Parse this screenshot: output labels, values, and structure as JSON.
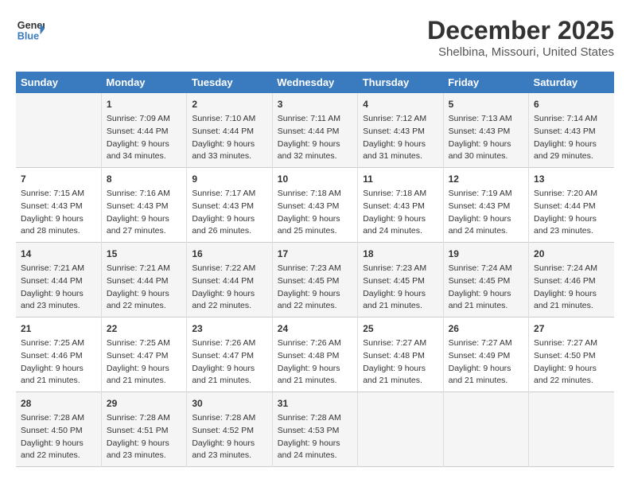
{
  "header": {
    "logo_general": "General",
    "logo_blue": "Blue",
    "month_title": "December 2025",
    "location": "Shelbina, Missouri, United States"
  },
  "days_of_week": [
    "Sunday",
    "Monday",
    "Tuesday",
    "Wednesday",
    "Thursday",
    "Friday",
    "Saturday"
  ],
  "weeks": [
    [
      {
        "day": "",
        "text": ""
      },
      {
        "day": "1",
        "text": "Sunrise: 7:09 AM\nSunset: 4:44 PM\nDaylight: 9 hours\nand 34 minutes."
      },
      {
        "day": "2",
        "text": "Sunrise: 7:10 AM\nSunset: 4:44 PM\nDaylight: 9 hours\nand 33 minutes."
      },
      {
        "day": "3",
        "text": "Sunrise: 7:11 AM\nSunset: 4:44 PM\nDaylight: 9 hours\nand 32 minutes."
      },
      {
        "day": "4",
        "text": "Sunrise: 7:12 AM\nSunset: 4:43 PM\nDaylight: 9 hours\nand 31 minutes."
      },
      {
        "day": "5",
        "text": "Sunrise: 7:13 AM\nSunset: 4:43 PM\nDaylight: 9 hours\nand 30 minutes."
      },
      {
        "day": "6",
        "text": "Sunrise: 7:14 AM\nSunset: 4:43 PM\nDaylight: 9 hours\nand 29 minutes."
      }
    ],
    [
      {
        "day": "7",
        "text": "Sunrise: 7:15 AM\nSunset: 4:43 PM\nDaylight: 9 hours\nand 28 minutes."
      },
      {
        "day": "8",
        "text": "Sunrise: 7:16 AM\nSunset: 4:43 PM\nDaylight: 9 hours\nand 27 minutes."
      },
      {
        "day": "9",
        "text": "Sunrise: 7:17 AM\nSunset: 4:43 PM\nDaylight: 9 hours\nand 26 minutes."
      },
      {
        "day": "10",
        "text": "Sunrise: 7:18 AM\nSunset: 4:43 PM\nDaylight: 9 hours\nand 25 minutes."
      },
      {
        "day": "11",
        "text": "Sunrise: 7:18 AM\nSunset: 4:43 PM\nDaylight: 9 hours\nand 24 minutes."
      },
      {
        "day": "12",
        "text": "Sunrise: 7:19 AM\nSunset: 4:43 PM\nDaylight: 9 hours\nand 24 minutes."
      },
      {
        "day": "13",
        "text": "Sunrise: 7:20 AM\nSunset: 4:44 PM\nDaylight: 9 hours\nand 23 minutes."
      }
    ],
    [
      {
        "day": "14",
        "text": "Sunrise: 7:21 AM\nSunset: 4:44 PM\nDaylight: 9 hours\nand 23 minutes."
      },
      {
        "day": "15",
        "text": "Sunrise: 7:21 AM\nSunset: 4:44 PM\nDaylight: 9 hours\nand 22 minutes."
      },
      {
        "day": "16",
        "text": "Sunrise: 7:22 AM\nSunset: 4:44 PM\nDaylight: 9 hours\nand 22 minutes."
      },
      {
        "day": "17",
        "text": "Sunrise: 7:23 AM\nSunset: 4:45 PM\nDaylight: 9 hours\nand 22 minutes."
      },
      {
        "day": "18",
        "text": "Sunrise: 7:23 AM\nSunset: 4:45 PM\nDaylight: 9 hours\nand 21 minutes."
      },
      {
        "day": "19",
        "text": "Sunrise: 7:24 AM\nSunset: 4:45 PM\nDaylight: 9 hours\nand 21 minutes."
      },
      {
        "day": "20",
        "text": "Sunrise: 7:24 AM\nSunset: 4:46 PM\nDaylight: 9 hours\nand 21 minutes."
      }
    ],
    [
      {
        "day": "21",
        "text": "Sunrise: 7:25 AM\nSunset: 4:46 PM\nDaylight: 9 hours\nand 21 minutes."
      },
      {
        "day": "22",
        "text": "Sunrise: 7:25 AM\nSunset: 4:47 PM\nDaylight: 9 hours\nand 21 minutes."
      },
      {
        "day": "23",
        "text": "Sunrise: 7:26 AM\nSunset: 4:47 PM\nDaylight: 9 hours\nand 21 minutes."
      },
      {
        "day": "24",
        "text": "Sunrise: 7:26 AM\nSunset: 4:48 PM\nDaylight: 9 hours\nand 21 minutes."
      },
      {
        "day": "25",
        "text": "Sunrise: 7:27 AM\nSunset: 4:48 PM\nDaylight: 9 hours\nand 21 minutes."
      },
      {
        "day": "26",
        "text": "Sunrise: 7:27 AM\nSunset: 4:49 PM\nDaylight: 9 hours\nand 21 minutes."
      },
      {
        "day": "27",
        "text": "Sunrise: 7:27 AM\nSunset: 4:50 PM\nDaylight: 9 hours\nand 22 minutes."
      }
    ],
    [
      {
        "day": "28",
        "text": "Sunrise: 7:28 AM\nSunset: 4:50 PM\nDaylight: 9 hours\nand 22 minutes."
      },
      {
        "day": "29",
        "text": "Sunrise: 7:28 AM\nSunset: 4:51 PM\nDaylight: 9 hours\nand 23 minutes."
      },
      {
        "day": "30",
        "text": "Sunrise: 7:28 AM\nSunset: 4:52 PM\nDaylight: 9 hours\nand 23 minutes."
      },
      {
        "day": "31",
        "text": "Sunrise: 7:28 AM\nSunset: 4:53 PM\nDaylight: 9 hours\nand 24 minutes."
      },
      {
        "day": "",
        "text": ""
      },
      {
        "day": "",
        "text": ""
      },
      {
        "day": "",
        "text": ""
      }
    ]
  ]
}
